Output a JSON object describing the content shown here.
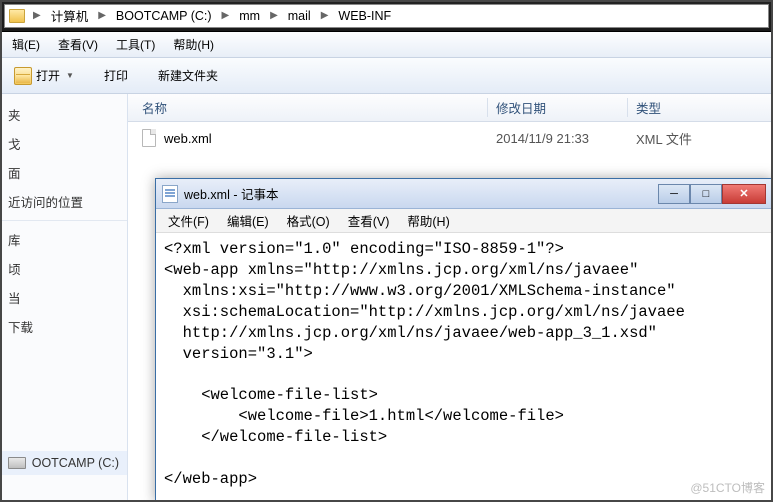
{
  "breadcrumb": [
    "计算机",
    "BOOTCAMP (C:)",
    "mm",
    "mail",
    "WEB-INF"
  ],
  "explorerMenu": [
    "辑(E)",
    "查看(V)",
    "工具(T)",
    "帮助(H)"
  ],
  "toolbar": {
    "open": "打开",
    "print": "打印",
    "newfolder": "新建文件夹"
  },
  "columns": {
    "name": "名称",
    "date": "修改日期",
    "type": "类型"
  },
  "file": {
    "name": "web.xml",
    "date": "2014/11/9 21:33",
    "type": "XML 文件"
  },
  "sidebar": {
    "items": [
      "夹",
      "戈",
      "面",
      "近访问的位置",
      "",
      "库",
      "顷",
      "当",
      "下载"
    ],
    "drive": "OOTCAMP (C:)"
  },
  "notepad": {
    "title": "web.xml - 记事本",
    "menu": [
      "文件(F)",
      "编辑(E)",
      "格式(O)",
      "查看(V)",
      "帮助(H)"
    ],
    "content": "<?xml version=\"1.0\" encoding=\"ISO-8859-1\"?>\n<web-app xmlns=\"http://xmlns.jcp.org/xml/ns/javaee\"\n  xmlns:xsi=\"http://www.w3.org/2001/XMLSchema-instance\"\n  xsi:schemaLocation=\"http://xmlns.jcp.org/xml/ns/javaee\n  http://xmlns.jcp.org/xml/ns/javaee/web-app_3_1.xsd\"\n  version=\"3.1\">\n\n    <welcome-file-list>\n        <welcome-file>1.html</welcome-file>\n    </welcome-file-list>\n\n</web-app>"
  },
  "watermark": "@51CTO博客"
}
